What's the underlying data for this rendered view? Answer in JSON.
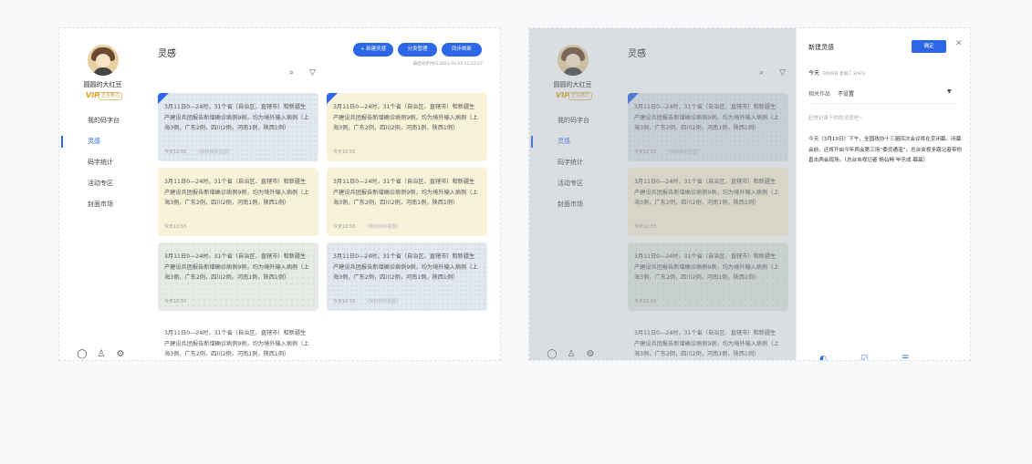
{
  "sidebar": {
    "username": "圆圆的大红豆",
    "vip_text": "VIP",
    "vip_badge": "正在努力",
    "nav": [
      "我的码字台",
      "灵感",
      "码字统计",
      "活动专区",
      "封面市场"
    ],
    "active_index": 1,
    "bottom_icons": [
      "chat-icon",
      "shirt-icon",
      "settings-icon"
    ]
  },
  "main": {
    "title": "灵感",
    "buttons": [
      "+ 新建灵感",
      "分类管理",
      "同步刷新"
    ],
    "sync_time": "最后同步时间 2021-03-05 12:23:27",
    "tools": [
      "search-icon",
      "filter-icon"
    ]
  },
  "card_text": "3月11日0—24时，31个省（自治区、直辖市）和新疆生产建设兵团报告新增确诊病例9例，均为境外输入病例（上海3例，广东2例，四川2例，河南1例，陕西1例）",
  "cards": [
    {
      "time": "今天10:55",
      "tag": "《我和我的祖国》",
      "color": "blue",
      "pinned": true
    },
    {
      "time": "今天10:55",
      "tag": "",
      "color": "yellow",
      "pinned": true
    },
    {
      "time": "今天10:55",
      "tag": "",
      "color": "yellow",
      "pinned": false
    },
    {
      "time": "今天10:55",
      "tag": "《我和我的祖国》",
      "color": "yellow",
      "pinned": false
    },
    {
      "time": "今天10:55",
      "tag": "",
      "color": "green",
      "pinned": false
    },
    {
      "time": "今天10:55",
      "tag": "《我和我的祖国》",
      "color": "blue",
      "pinned": false
    },
    {
      "time": "",
      "tag": "",
      "color": "plain",
      "pinned": false
    }
  ],
  "drawer": {
    "title": "新建灵感",
    "ok_label": "确定",
    "date_label": "今天",
    "date_sub": "3月09日 星期二 分923",
    "related_label": "相关作品",
    "related_value": "不设置",
    "placeholder": "赶快记录下你的灵感吧~",
    "body": "今天（3月10日）下午，全国政协十三届四次会议将在京闭幕。闭幕会前，还将开启今年两会第三场“委员通道”，总台央视多路记者带你直击两会现场。（总台央视记者 杨弘畅 毕乐成 薛晨）",
    "tools": [
      "palette-icon",
      "checkbox-icon",
      "list-icon",
      "image-icon"
    ]
  },
  "colors": {
    "accent": "#2b67e6",
    "card_blue": "#e3e9f0",
    "card_yellow": "#faf1d9",
    "card_green": "#e6ebe6"
  }
}
